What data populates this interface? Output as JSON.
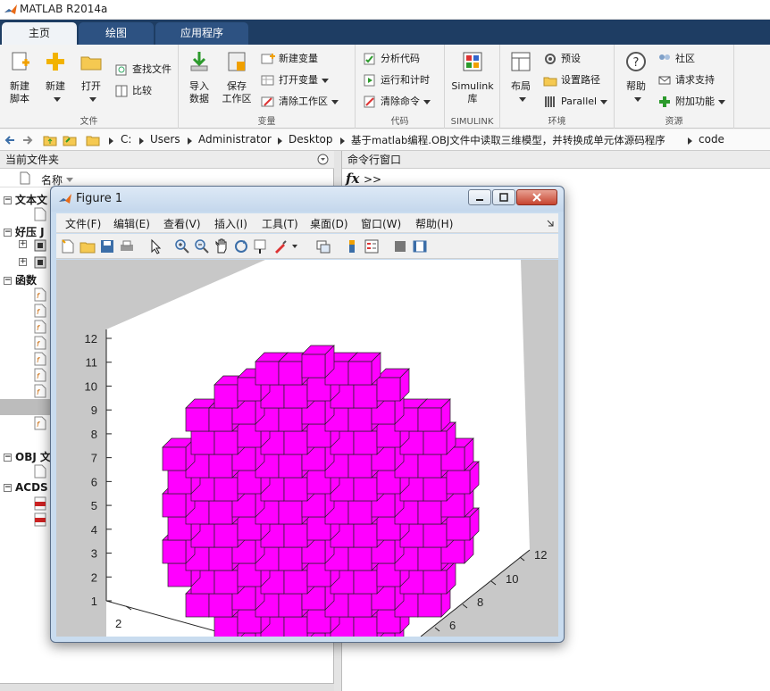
{
  "app": {
    "title": "MATLAB R2014a"
  },
  "tabs": [
    {
      "label": "主页",
      "active": true
    },
    {
      "label": "绘图",
      "active": false
    },
    {
      "label": "应用程序",
      "active": false
    }
  ],
  "ribbon": {
    "file": {
      "label": "文件",
      "new_script": "新建\n脚本",
      "new": "新建",
      "open": "打开",
      "find_files": "查找文件",
      "compare": "比较"
    },
    "variable": {
      "label": "变量",
      "import": "导入\n数据",
      "save_ws": "保存\n工作区",
      "new_var": "新建变量",
      "open_var": "打开变量",
      "clear_ws": "清除工作区"
    },
    "code": {
      "label": "代码",
      "analyze": "分析代码",
      "run_time": "运行和计时",
      "clear_cmds": "清除命令"
    },
    "simulink": {
      "label": "SIMULINK",
      "lib": "Simulink\n库"
    },
    "env": {
      "label": "环境",
      "layout": "布局",
      "prefs": "预设",
      "set_path": "设置路径",
      "parallel": "Parallel"
    },
    "resources": {
      "label": "资源",
      "help": "帮助",
      "community": "社区",
      "support": "请求支持",
      "addons": "附加功能"
    }
  },
  "address": {
    "crumbs": [
      "C:",
      "Users",
      "Administrator",
      "Desktop",
      "基于matlab编程.OBJ文件中读取三维模型，并转换成单元体源码程序",
      "code"
    ]
  },
  "current_folder": {
    "title": "当前文件夹",
    "col_name": "名称",
    "groups": [
      {
        "label": "文本文"
      },
      {
        "label": "好压 J"
      },
      {
        "label": "函数"
      },
      {
        "label": "OBJ 文"
      },
      {
        "label": "ACDS"
      }
    ]
  },
  "command_window": {
    "title": "命令行窗口",
    "fx": "fx",
    "prompt": ">>"
  },
  "figure": {
    "title": "Figure 1",
    "menus": [
      "文件(F)",
      "编辑(E)",
      "查看(V)",
      "插入(I)",
      "工具(T)",
      "桌面(D)",
      "窗口(W)",
      "帮助(H)"
    ]
  },
  "chart_data": {
    "type": "3d-voxel",
    "color": "#ff00ff",
    "z_ticks": [
      1,
      2,
      3,
      4,
      5,
      6,
      7,
      8,
      9,
      10,
      11,
      12
    ],
    "y_ticks": [
      6,
      8,
      10,
      12
    ],
    "x_ticks": [
      2
    ],
    "zlim": [
      1,
      12
    ]
  }
}
